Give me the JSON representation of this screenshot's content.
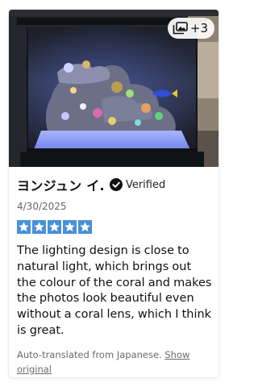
{
  "review": {
    "photo": {
      "description_icon": "aquarium-photo",
      "more_count": "+3",
      "badge_icon": "photo-stack-icon"
    },
    "author": "ヨンジュン イ.",
    "verified_icon": "check-circle-icon",
    "verified_label": "Verified",
    "date": "4/30/2025",
    "rating": 5,
    "rating_max": 5,
    "star_color": "#4a90d9",
    "text": "The lighting design is close to natural light, which brings out the colour of the coral and makes the photos look beautiful even without a coral lens, which I think is great.",
    "translation_note": "Auto-translated from Japanese.",
    "show_original_label": "Show original"
  }
}
